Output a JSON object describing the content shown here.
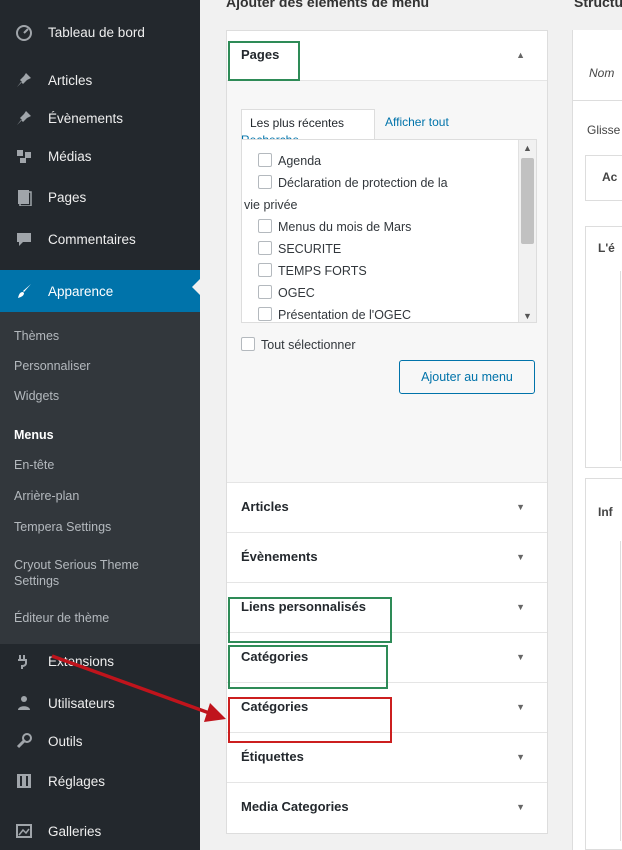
{
  "sidebar": {
    "items": [
      {
        "label": "Tableau de bord",
        "icon": "dashboard-icon"
      },
      {
        "label": "Articles",
        "icon": "pin-icon"
      },
      {
        "label": "Évènements",
        "icon": "pin-icon"
      },
      {
        "label": "Médias",
        "icon": "media-icon"
      },
      {
        "label": "Pages",
        "icon": "pages-icon"
      },
      {
        "label": "Commentaires",
        "icon": "comment-icon"
      },
      {
        "label": "Apparence",
        "icon": "brush-icon"
      },
      {
        "label": "Extensions",
        "icon": "plugin-icon"
      },
      {
        "label": "Utilisateurs",
        "icon": "users-icon"
      },
      {
        "label": "Outils",
        "icon": "wrench-icon"
      },
      {
        "label": "Réglages",
        "icon": "settings-icon"
      },
      {
        "label": "Galleries",
        "icon": "gallery-icon"
      }
    ],
    "submenu": [
      "Thèmes",
      "Personnaliser",
      "Widgets",
      "Menus",
      "En-tête",
      "Arrière-plan",
      "Tempera Settings",
      "Cryout Serious Theme Settings",
      "Éditeur de thème"
    ]
  },
  "header": {
    "left_title": "Ajouter des éléments de menu",
    "right_title": "Structure du menu"
  },
  "pages_panel": {
    "title": "Pages",
    "tab_recent": "Les plus récentes",
    "tab_all": "Afficher tout",
    "tab_search": "Recherche",
    "items": [
      "Agenda",
      "Déclaration de protection de la",
      "vie privée",
      "Menus du mois de Mars",
      "SECURITE",
      "TEMPS FORTS",
      "OGEC",
      "Présentation de l'OGEC"
    ],
    "select_all": "Tout sélectionner",
    "add_button": "Ajouter au menu"
  },
  "accordion": [
    "Articles",
    "Évènements",
    "Liens personnalisés",
    "Catégories",
    "Catégories",
    "Étiquettes",
    "Media Categories"
  ],
  "right_col": {
    "nom": "Nom",
    "glisse": "Glisse",
    "box1": "Ac",
    "box2": "L'é",
    "box3": "Inf"
  },
  "colors": {
    "sidebar_bg": "#23282d",
    "active_bg": "#0073aa",
    "highlight_green": "#2e8b57",
    "highlight_red": "#cc1f1f",
    "arrow_red": "#c0141c"
  }
}
